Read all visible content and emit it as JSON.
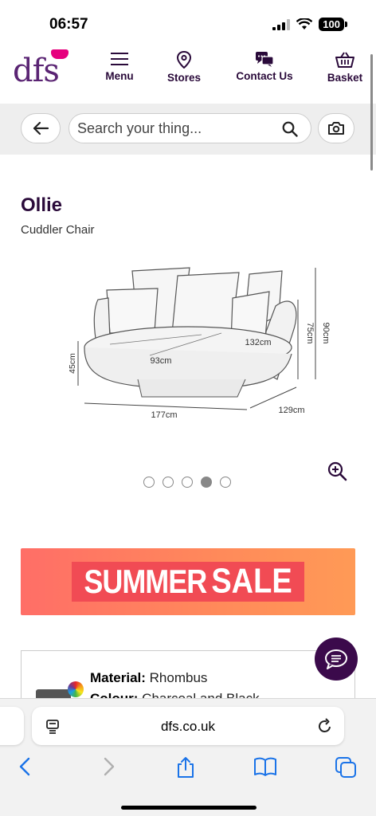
{
  "status_bar": {
    "time": "06:57",
    "battery": "100"
  },
  "header": {
    "logo": "dfs",
    "nav": [
      {
        "label": "Menu",
        "icon": "hamburger-icon"
      },
      {
        "label": "Stores",
        "icon": "location-pin-icon"
      },
      {
        "label": "Contact Us",
        "icon": "chat-bubbles-icon"
      },
      {
        "label": "Basket",
        "icon": "basket-icon"
      }
    ]
  },
  "search": {
    "placeholder": "Search your thing..."
  },
  "product": {
    "title": "Ollie",
    "subtitle": "Cuddler Chair",
    "dimensions": {
      "width": "177cm",
      "depth": "129cm",
      "seat_height": "45cm",
      "height_back": "75cm",
      "height_total": "90cm",
      "seat_width": "93cm",
      "seat_diag": "132cm"
    },
    "carousel": {
      "count": 5,
      "active_index": 3
    }
  },
  "banner": {
    "word1": "SUMMER",
    "word2": "SALE"
  },
  "details": {
    "material_label": "Material:",
    "material_value": "Rhombus",
    "colour_label": "Colour:",
    "colour_value": "Charcoal and Black"
  },
  "browser": {
    "url": "dfs.co.uk"
  },
  "colors": {
    "brand_purple": "#5a2473",
    "banner": "#ff7a5e",
    "chat_button": "#3b0a4b",
    "ios_blue": "#1a73e8"
  }
}
